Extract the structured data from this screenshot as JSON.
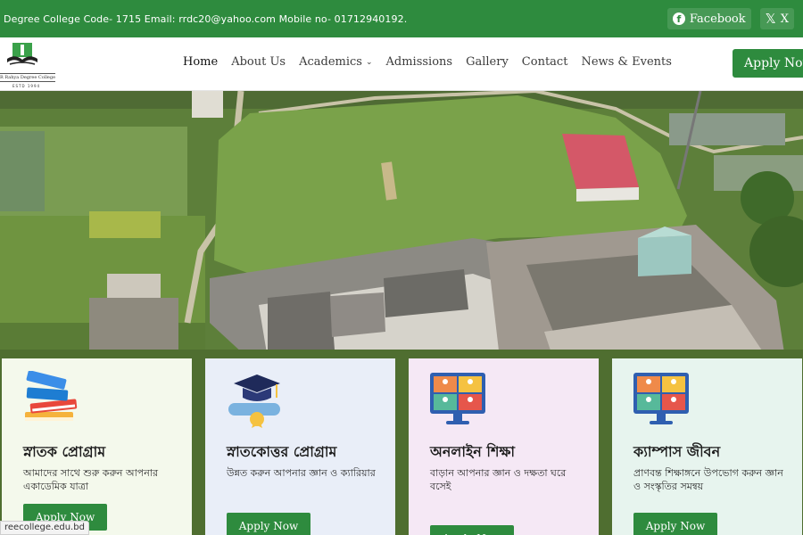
{
  "topbar": {
    "contact_info": "Degree College Code- 1715  Email: rrdc20@yahoo.com  Mobile no- 01712940192.",
    "facebook_label": "Facebook",
    "x_label": "X",
    "background": "#2e8b3e"
  },
  "logo": {
    "college_name": "R Rahya Degree College",
    "estd": "ESTD 1994"
  },
  "nav": {
    "items": [
      "Home",
      "About Us",
      "Academics",
      "Admissions",
      "Gallery",
      "Contact",
      "News & Events"
    ],
    "apply_label": "Apply Now"
  },
  "cards": [
    {
      "title": "স্নাতক প্রোগ্রাম",
      "desc": "আমাদের সাথে শুরু করুন আপনার একাডেমিক যাত্রা",
      "button": "Apply Now",
      "bg": "#f4f9ec",
      "icon": "books-icon"
    },
    {
      "title": "স্নাতকোত্তর প্রোগ্রাম",
      "desc": "উন্নত করুন আপনার জ্ঞান ও ক্যারিয়ার",
      "button": "Apply Now",
      "bg": "#e9eef8",
      "icon": "graduation-cap-icon"
    },
    {
      "title": "অনলাইন শিক্ষা",
      "desc": "বাড়ান আপনার জ্ঞান ও দক্ষতা ঘরে বসেই",
      "button": "Apply Now",
      "bg": "#f5e8f5",
      "icon": "video-conference-icon"
    },
    {
      "title": "ক্যাম্পাস জীবন",
      "desc": "প্রাণবন্ত শিক্ষাঙ্গনে উপভোগ করুন জ্ঞান ও সংস্কৃতির সমন্বয়",
      "button": "Apply Now",
      "bg": "#e7f4ee",
      "icon": "video-conference-icon"
    }
  ],
  "status_url": "reecollege.edu.bd",
  "colors": {
    "accent": "#2e8b3e"
  }
}
